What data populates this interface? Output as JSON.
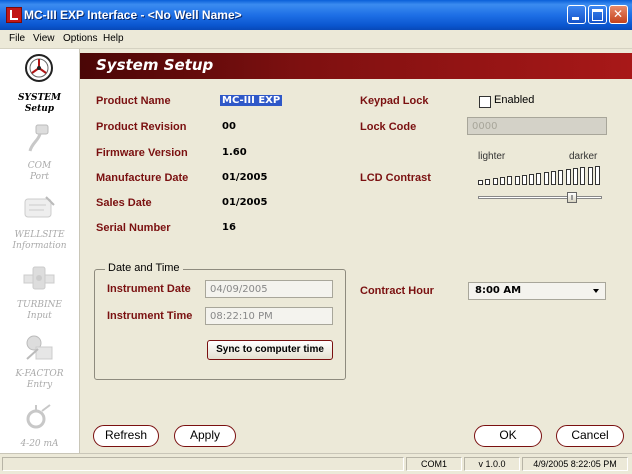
{
  "window": {
    "title": "MC-III EXP Interface - <No Well Name>"
  },
  "menu": {
    "items": [
      "File",
      "View",
      "Options",
      "Help"
    ]
  },
  "sidebar": {
    "items": [
      {
        "line1": "SYSTEM",
        "line2": "Setup",
        "icon": "system-gauge-icon",
        "active": true
      },
      {
        "line1": "COM",
        "line2": "Port",
        "icon": "com-cable-icon",
        "active": false
      },
      {
        "line1": "WELLSITE",
        "line2": "Information",
        "icon": "wellsite-pen-icon",
        "active": false
      },
      {
        "line1": "TURBINE",
        "line2": "Input",
        "icon": "turbine-icon",
        "active": false
      },
      {
        "line1": "K-FACTOR",
        "line2": "Entry",
        "icon": "k-factor-icon",
        "active": false
      },
      {
        "line1": "4-20 mA",
        "line2": "",
        "icon": "analog-output-icon",
        "active": false
      }
    ]
  },
  "header": {
    "title": "System Setup"
  },
  "system": {
    "product_name_label": "Product Name",
    "product_name": "MC-III EXP",
    "product_revision_label": "Product Revision",
    "product_revision": "00",
    "firmware_version_label": "Firmware Version",
    "firmware_version": "1.60",
    "manufacture_date_label": "Manufacture Date",
    "manufacture_date": "01/2005",
    "sales_date_label": "Sales Date",
    "sales_date": "01/2005",
    "serial_number_label": "Serial Number",
    "serial_number": "16"
  },
  "keypad": {
    "lock_label": "Keypad Lock",
    "enabled_label": "Enabled",
    "enabled": false,
    "lock_code_label": "Lock Code",
    "lock_code": "0000"
  },
  "lcd": {
    "label": "LCD Contrast",
    "lighter_label": "lighter",
    "darker_label": "darker",
    "level_fraction": 0.78
  },
  "datetime": {
    "group_title": "Date and Time",
    "instrument_date_label": "Instrument Date",
    "instrument_date": "04/09/2005",
    "instrument_time_label": "Instrument Time",
    "instrument_time": "08:22:10 PM",
    "sync_label": "Sync to computer time"
  },
  "contract": {
    "label": "Contract Hour",
    "value": "8:00 AM"
  },
  "buttons": {
    "refresh": "Refresh",
    "apply": "Apply",
    "ok": "OK",
    "cancel": "Cancel"
  },
  "status": {
    "port": "COM1",
    "version": "v 1.0.0",
    "timestamp": "4/9/2005 8:22:05 PM"
  },
  "colors": {
    "accent": "#7a1010",
    "header_start": "#4a0606",
    "header_end": "#a81818",
    "selection": "#2f58c8"
  }
}
